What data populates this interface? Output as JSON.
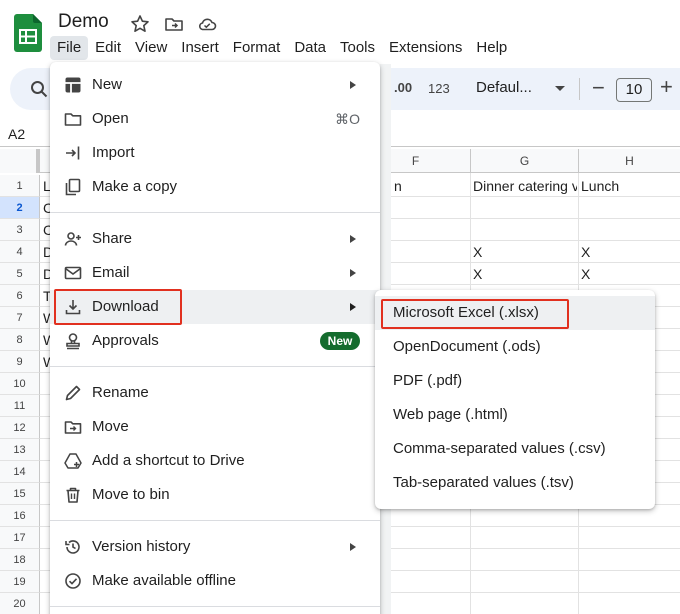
{
  "header": {
    "title": "Demo",
    "menu": [
      "File",
      "Edit",
      "View",
      "Insert",
      "Format",
      "Data",
      "Tools",
      "Extensions",
      "Help"
    ]
  },
  "toolbar": {
    "decimal_label": ".00",
    "number_format_label": "123",
    "font_name": "Defaul...",
    "font_size": "10",
    "minus": "−",
    "plus": "+"
  },
  "name_box": "A2",
  "columns": [
    "F",
    "G",
    "H"
  ],
  "rows": [
    "1",
    "2",
    "3",
    "4",
    "5",
    "6",
    "7",
    "8",
    "9",
    "10",
    "11",
    "12",
    "13",
    "14",
    "15",
    "16",
    "17",
    "18",
    "19",
    "20"
  ],
  "cells": {
    "a1": "L",
    "a2": "C",
    "a3": "C",
    "a4": "D",
    "a5": "D",
    "a6": "T",
    "a7": "W",
    "a8": "W",
    "a9": "W",
    "f1": "n",
    "g1": "Dinner catering v",
    "h1": "Lunch",
    "g4": "X",
    "h4": "X",
    "g5": "X",
    "h5": "X"
  },
  "file_menu": {
    "items": [
      {
        "label": "New",
        "icon": "new-sheet-icon"
      },
      {
        "label": "Open",
        "icon": "folder-icon",
        "shortcut": "⌘O"
      },
      {
        "label": "Import",
        "icon": "import-icon"
      },
      {
        "label": "Make a copy",
        "icon": "copy-icon"
      },
      {
        "label": "Share",
        "icon": "person-add-icon"
      },
      {
        "label": "Email",
        "icon": "email-icon"
      },
      {
        "label": "Download",
        "icon": "download-icon"
      },
      {
        "label": "Approvals",
        "icon": "approvals-icon",
        "badge": "New"
      },
      {
        "label": "Rename",
        "icon": "pencil-icon"
      },
      {
        "label": "Move",
        "icon": "move-folder-icon"
      },
      {
        "label": "Add a shortcut to Drive",
        "icon": "drive-shortcut-icon"
      },
      {
        "label": "Move to bin",
        "icon": "trash-icon"
      },
      {
        "label": "Version history",
        "icon": "history-icon"
      },
      {
        "label": "Make available offline",
        "icon": "offline-icon"
      }
    ]
  },
  "download_submenu": {
    "items": [
      "Microsoft Excel (.xlsx)",
      "OpenDocument (.ods)",
      "PDF (.pdf)",
      "Web page (.html)",
      "Comma-separated values (.csv)",
      "Tab-separated values (.tsv)"
    ]
  },
  "colors": {
    "highlight_box": "#e1301f",
    "approvals_badge": "#146c2e",
    "sheets_green": "#1e8e3e"
  }
}
